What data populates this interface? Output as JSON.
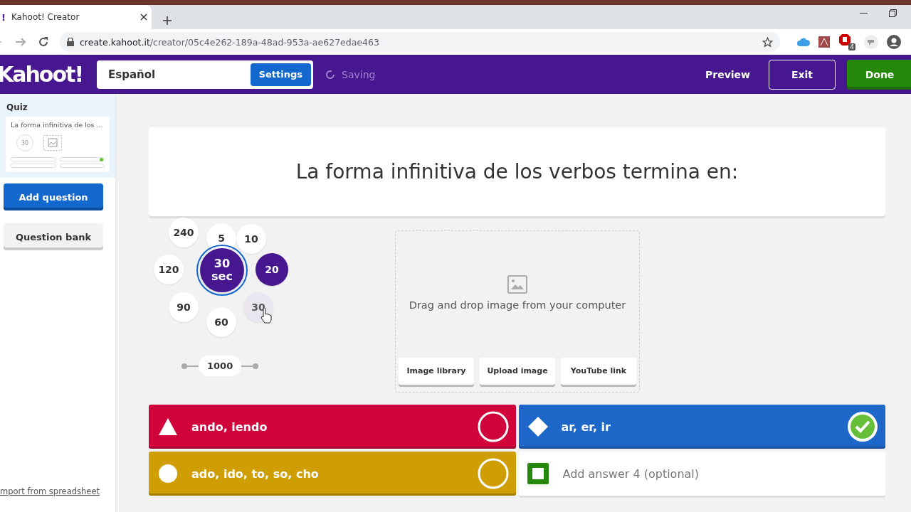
{
  "browser": {
    "favicon": "!",
    "tab_title": "Kahoot! Creator",
    "url_host": "create.kahoot.it",
    "url_path": "/creator/05c4e262-189a-48ad-953a-ae627edae463",
    "extension_badge": "4"
  },
  "header": {
    "logo": "Kahoot!",
    "title_value": "Español",
    "settings": "Settings",
    "status": "Saving",
    "preview": "Preview",
    "exit": "Exit",
    "done": "Done"
  },
  "sidebar": {
    "section": "Quiz",
    "card": {
      "title": "La forma infinitiva de los ...",
      "time": "30",
      "selected": true
    },
    "add_question": "Add question",
    "question_bank": "Question bank",
    "import_link": "mport from spreadsheet"
  },
  "question": {
    "text": "La forma infinitiva de los verbos termina en:"
  },
  "time_options": [
    {
      "label": "240",
      "selected": false,
      "highlighted": false
    },
    {
      "label": "5",
      "selected": false,
      "highlighted": false
    },
    {
      "label": "10",
      "selected": false,
      "highlighted": false
    },
    {
      "label": "120",
      "selected": false,
      "highlighted": false
    },
    {
      "label": "30 sec",
      "selected": true,
      "highlighted": false
    },
    {
      "label": "20",
      "selected": false,
      "highlighted": true
    },
    {
      "label": "90",
      "selected": false,
      "highlighted": false
    },
    {
      "label": "30",
      "selected": false,
      "highlighted": false,
      "hovered": true
    },
    {
      "label": "60",
      "selected": false,
      "highlighted": false
    }
  ],
  "points": {
    "value": "1000"
  },
  "media": {
    "hint": "Drag and drop image from your computer",
    "buttons": [
      "Image library",
      "Upload image",
      "YouTube link"
    ]
  },
  "answers": [
    {
      "kind": "triangle",
      "color": "#d0033b",
      "text": "ando, iendo",
      "correct": false
    },
    {
      "kind": "diamond",
      "color": "#1d67c9",
      "text": "ar, er, ir",
      "correct": true
    },
    {
      "kind": "circle",
      "color": "#cf9e04",
      "text": "ado, ido, to, so, cho",
      "correct": false
    },
    {
      "kind": "square",
      "color": "#26890c",
      "placeholder": "Add answer 4 (optional)"
    }
  ]
}
